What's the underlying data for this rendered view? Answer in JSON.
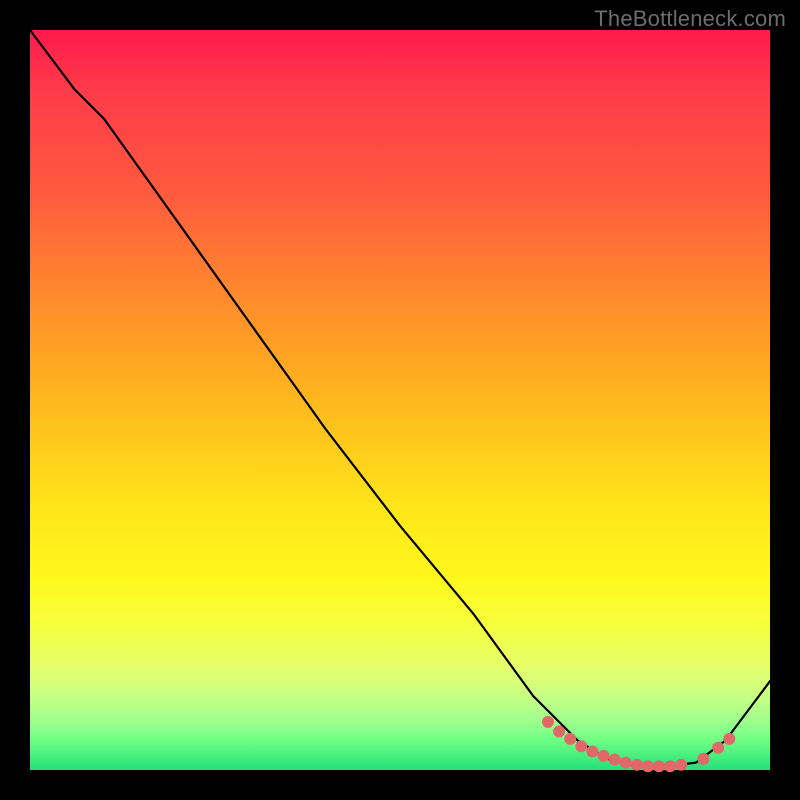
{
  "watermark": "TheBottleneck.com",
  "chart_data": {
    "type": "line",
    "title": "",
    "xlabel": "",
    "ylabel": "",
    "xlim": [
      0,
      100
    ],
    "ylim": [
      0,
      100
    ],
    "series": [
      {
        "name": "bottleneck-curve",
        "x": [
          0,
          6,
          10,
          20,
          30,
          40,
          50,
          60,
          68,
          74,
          78,
          82,
          86,
          90,
          94,
          100
        ],
        "y": [
          100,
          92,
          88,
          74,
          60,
          46,
          33,
          21,
          10,
          4,
          1.5,
          0.5,
          0.5,
          1,
          4,
          12
        ]
      }
    ],
    "highlight_points": {
      "name": "selected-range-dots",
      "x": [
        70,
        71.5,
        73,
        74.5,
        76,
        77.5,
        79,
        80.5,
        82,
        83.5,
        85,
        86.5,
        88,
        91,
        93,
        94.5
      ],
      "y": [
        6.5,
        5.2,
        4.2,
        3.2,
        2.5,
        1.9,
        1.4,
        1.0,
        0.7,
        0.5,
        0.5,
        0.5,
        0.7,
        1.5,
        3.0,
        4.2
      ]
    },
    "background_gradient": {
      "top": "#ff1a4c",
      "mid_upper": "#ff8a2c",
      "mid": "#ffe41a",
      "mid_lower": "#e6ff6a",
      "bottom": "#24e07a"
    }
  }
}
